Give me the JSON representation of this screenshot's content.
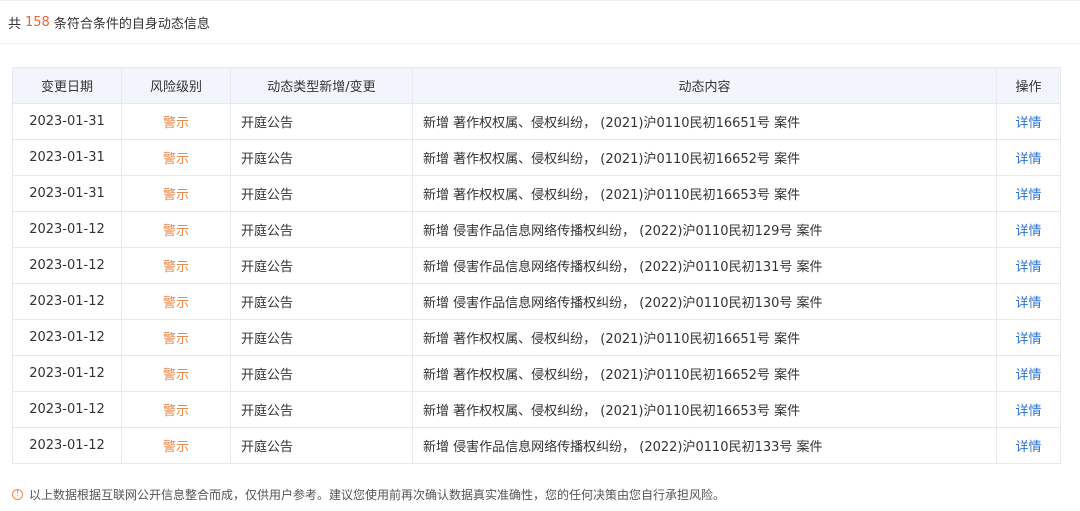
{
  "summary": {
    "prefix": "共",
    "count": "158",
    "suffix": "条符合条件的自身动态信息"
  },
  "table": {
    "headers": {
      "date": "变更日期",
      "level": "风险级别",
      "type": "动态类型新增/变更",
      "content": "动态内容",
      "operation": "操作"
    },
    "rows": [
      {
        "date": "2023-01-31",
        "level": "警示",
        "type": "开庭公告",
        "content": "新增 著作权权属、侵权纠纷， (2021)沪0110民初16651号 案件",
        "action": "详情"
      },
      {
        "date": "2023-01-31",
        "level": "警示",
        "type": "开庭公告",
        "content": "新增 著作权权属、侵权纠纷， (2021)沪0110民初16652号 案件",
        "action": "详情"
      },
      {
        "date": "2023-01-31",
        "level": "警示",
        "type": "开庭公告",
        "content": "新增 著作权权属、侵权纠纷， (2021)沪0110民初16653号 案件",
        "action": "详情"
      },
      {
        "date": "2023-01-12",
        "level": "警示",
        "type": "开庭公告",
        "content": "新增 侵害作品信息网络传播权纠纷， (2022)沪0110民初129号 案件",
        "action": "详情"
      },
      {
        "date": "2023-01-12",
        "level": "警示",
        "type": "开庭公告",
        "content": "新增 侵害作品信息网络传播权纠纷， (2022)沪0110民初131号 案件",
        "action": "详情"
      },
      {
        "date": "2023-01-12",
        "level": "警示",
        "type": "开庭公告",
        "content": "新增 侵害作品信息网络传播权纠纷， (2022)沪0110民初130号 案件",
        "action": "详情"
      },
      {
        "date": "2023-01-12",
        "level": "警示",
        "type": "开庭公告",
        "content": "新增 著作权权属、侵权纠纷， (2021)沪0110民初16651号 案件",
        "action": "详情"
      },
      {
        "date": "2023-01-12",
        "level": "警示",
        "type": "开庭公告",
        "content": "新增 著作权权属、侵权纠纷， (2021)沪0110民初16652号 案件",
        "action": "详情"
      },
      {
        "date": "2023-01-12",
        "level": "警示",
        "type": "开庭公告",
        "content": "新增 著作权权属、侵权纠纷， (2021)沪0110民初16653号 案件",
        "action": "详情"
      },
      {
        "date": "2023-01-12",
        "level": "警示",
        "type": "开庭公告",
        "content": "新增 侵害作品信息网络传播权纠纷， (2022)沪0110民初133号 案件",
        "action": "详情"
      }
    ]
  },
  "footnote": {
    "icon": "info-circle-icon",
    "text": "以上数据根据互联网公开信息整合而成，仅供用户参考。建议您使用前再次确认数据真实准确性，您的任何决策由您自行承担风险。"
  },
  "colors": {
    "accent_count": "#f0632d",
    "risk_level": "#f0884a",
    "link": "#2b74d6",
    "header_bg": "#f2f6fc"
  }
}
